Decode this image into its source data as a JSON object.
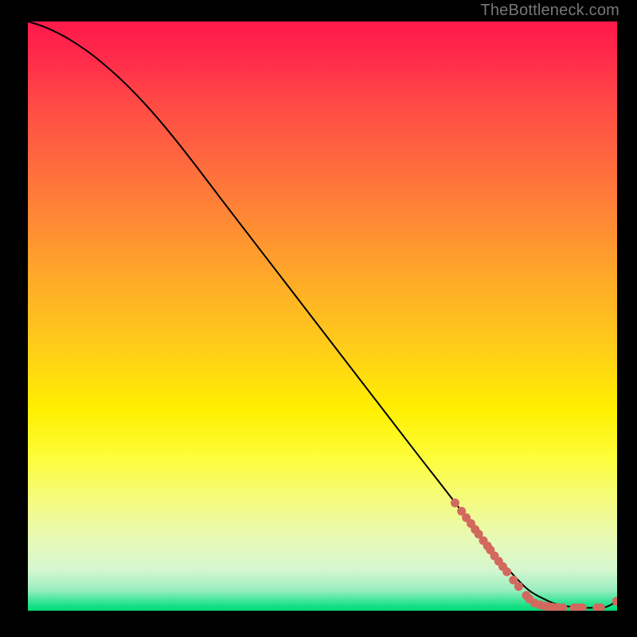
{
  "watermark": "TheBottleneck.com",
  "colors": {
    "page_bg": "#000000",
    "watermark": "#777777",
    "curve": "#000000",
    "marker_fill": "#d2695e",
    "marker_stroke": "#8c3b33"
  },
  "chart_data": {
    "type": "line",
    "title": "",
    "xlabel": "",
    "ylabel": "",
    "xlim": [
      0,
      100
    ],
    "ylim": [
      0,
      100
    ],
    "legend": false,
    "grid": false,
    "series": [
      {
        "name": "curve",
        "x": [
          0,
          3,
          7,
          12,
          18,
          25,
          35,
          45,
          55,
          65,
          72,
          78,
          82,
          85,
          88,
          90,
          92,
          94,
          96,
          98,
          100
        ],
        "y": [
          100,
          99,
          97,
          93.5,
          88,
          80,
          67,
          54,
          41,
          28,
          19,
          11,
          6.5,
          3.5,
          1.8,
          1.0,
          0.7,
          0.5,
          0.5,
          0.6,
          1.6
        ]
      }
    ],
    "markers": [
      {
        "x": 72.5,
        "y": 18.3
      },
      {
        "x": 73.6,
        "y": 16.9
      },
      {
        "x": 74.4,
        "y": 15.8
      },
      {
        "x": 75.2,
        "y": 14.8
      },
      {
        "x": 75.9,
        "y": 13.8
      },
      {
        "x": 76.5,
        "y": 13.0
      },
      {
        "x": 77.3,
        "y": 11.9
      },
      {
        "x": 78.0,
        "y": 11.0
      },
      {
        "x": 78.5,
        "y": 10.3
      },
      {
        "x": 79.2,
        "y": 9.3
      },
      {
        "x": 79.9,
        "y": 8.4
      },
      {
        "x": 80.6,
        "y": 7.5
      },
      {
        "x": 81.3,
        "y": 6.6
      },
      {
        "x": 82.4,
        "y": 5.2
      },
      {
        "x": 83.3,
        "y": 4.1
      },
      {
        "x": 84.6,
        "y": 2.6
      },
      {
        "x": 85.1,
        "y": 2.0
      },
      {
        "x": 86.0,
        "y": 1.3
      },
      {
        "x": 86.9,
        "y": 1.0
      },
      {
        "x": 87.7,
        "y": 0.8
      },
      {
        "x": 88.4,
        "y": 0.7
      },
      {
        "x": 89.0,
        "y": 0.6
      },
      {
        "x": 89.9,
        "y": 0.55
      },
      {
        "x": 90.8,
        "y": 0.5
      },
      {
        "x": 92.7,
        "y": 0.5
      },
      {
        "x": 93.4,
        "y": 0.5
      },
      {
        "x": 94.1,
        "y": 0.5
      },
      {
        "x": 96.6,
        "y": 0.5
      },
      {
        "x": 97.2,
        "y": 0.5
      },
      {
        "x": 99.9,
        "y": 1.6
      }
    ]
  }
}
